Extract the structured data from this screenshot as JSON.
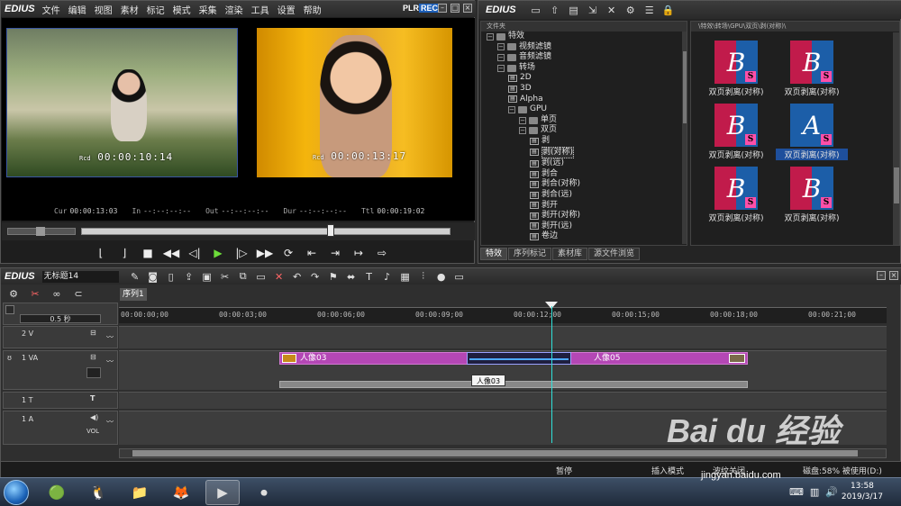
{
  "player": {
    "logo": "EDIUS",
    "menu": [
      "文件",
      "编辑",
      "视图",
      "素材",
      "标记",
      "模式",
      "采集",
      "渲染",
      "工具",
      "设置",
      "帮助"
    ],
    "plr": "PLR",
    "rec": "REC",
    "src_tc_prefix": "Rcd",
    "src_tc": "00:00:10:14",
    "rec_tc_prefix": "Rcd",
    "rec_tc": "00:00:13:17",
    "cur_label": "Cur",
    "cur": "00:00:13:03",
    "in_label": "In",
    "in": "--:--:--:--",
    "out_label": "Out",
    "out": "--:--:--:--",
    "dur_label": "Dur",
    "dur": "--:--:--:--",
    "ttl_label": "Ttl",
    "ttl": "00:00:19:02"
  },
  "bin": {
    "logo": "EDIUS",
    "tree_header": "文件夹",
    "path": "\\特效\\转场\\GPU\\双页\\剥(对称)\\",
    "tree": [
      {
        "label": "特效",
        "indent": 0,
        "type": "folder"
      },
      {
        "label": "视频滤镜",
        "indent": 1,
        "type": "folder"
      },
      {
        "label": "音频滤镜",
        "indent": 1,
        "type": "folder"
      },
      {
        "label": "转场",
        "indent": 1,
        "type": "folder"
      },
      {
        "label": "2D",
        "indent": 2,
        "type": "fx"
      },
      {
        "label": "3D",
        "indent": 2,
        "type": "fx"
      },
      {
        "label": "Alpha",
        "indent": 2,
        "type": "fx"
      },
      {
        "label": "GPU",
        "indent": 2,
        "type": "folder"
      },
      {
        "label": "单页",
        "indent": 3,
        "type": "folder"
      },
      {
        "label": "双页",
        "indent": 3,
        "type": "folder"
      },
      {
        "label": "剥",
        "indent": 4,
        "type": "fx"
      },
      {
        "label": "剥(对称)",
        "indent": 4,
        "type": "fx",
        "selected": true
      },
      {
        "label": "剥(远)",
        "indent": 4,
        "type": "fx"
      },
      {
        "label": "剥合",
        "indent": 4,
        "type": "fx"
      },
      {
        "label": "剥合(对称)",
        "indent": 4,
        "type": "fx"
      },
      {
        "label": "剥合(远)",
        "indent": 4,
        "type": "fx"
      },
      {
        "label": "剥开",
        "indent": 4,
        "type": "fx"
      },
      {
        "label": "剥开(对称)",
        "indent": 4,
        "type": "fx"
      },
      {
        "label": "剥开(远)",
        "indent": 4,
        "type": "fx"
      },
      {
        "label": "卷边",
        "indent": 4,
        "type": "fx"
      }
    ],
    "thumbs": [
      {
        "letter": "B",
        "label": "双页剥离(对称)",
        "highlight": false
      },
      {
        "letter": "B",
        "label": "双页剥离(对称)",
        "highlight": false
      },
      {
        "letter": "B",
        "label": "双页剥离(对称)",
        "highlight": false
      },
      {
        "letter": "A",
        "label": "双页剥离(对称)",
        "highlight": true
      },
      {
        "letter": "B",
        "label": "双页剥离(对称)",
        "highlight": false
      },
      {
        "letter": "B",
        "label": "双页剥离(对称)",
        "highlight": false
      }
    ],
    "tabs": [
      "特效",
      "序列标记",
      "素材库",
      "源文件浏览"
    ]
  },
  "timeline": {
    "logo": "EDIUS",
    "project": "无标题14",
    "sequence_tab": "序列1",
    "zoom": "0.5 秒",
    "ruler": [
      "00:00:00;00",
      "00:00:03;00",
      "00:00:06;00",
      "00:00:09;00",
      "00:00:12;00",
      "00:00:15;00",
      "00:00:18;00",
      "00:00:21;00"
    ],
    "tracks": [
      {
        "name": "2 V"
      },
      {
        "name": "1 VA"
      },
      {
        "name": "1 T"
      },
      {
        "name": "1 A",
        "vol": "VOL"
      }
    ],
    "clip_a": "人像03",
    "clip_b": "人像05",
    "tooltip": "人像03",
    "status": {
      "state": "暂停",
      "mode": "插入模式",
      "ripple": "波纹关闭",
      "disk": "磁盘:58% 被使用(D:)"
    }
  },
  "taskbar": {
    "time": "13:58",
    "date": "2019/3/17"
  },
  "watermark": {
    "big": "Bai du 经验",
    "url": "jingyan.baidu.com"
  },
  "colors": {
    "accent": "#1d5fb8",
    "clip": "#b447b5",
    "playhead": "#2fe0d8",
    "tip_bg": "#f4f4f4"
  }
}
